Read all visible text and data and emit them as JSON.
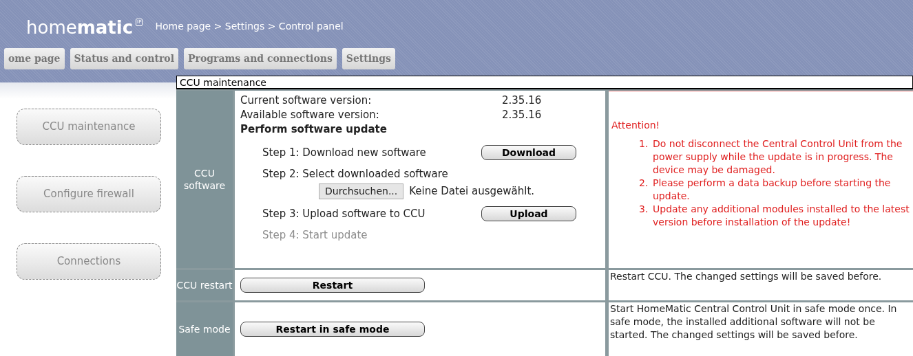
{
  "header": {
    "logo": {
      "light": "home",
      "bold": "matic",
      "badge": "IP"
    },
    "breadcrumb": "Home page > Settings > Control panel"
  },
  "tabs": [
    {
      "label": "ome page"
    },
    {
      "label": "Status and control"
    },
    {
      "label": "Programs and connections"
    },
    {
      "label": "Settings"
    }
  ],
  "sidebar": {
    "items": [
      {
        "label": "CCU maintenance"
      },
      {
        "label": "Configure firewall"
      },
      {
        "label": "Connections"
      }
    ]
  },
  "panel": {
    "title": "CCU maintenance",
    "sections": [
      {
        "kind": "software",
        "label": "CCU software",
        "versions": [
          {
            "label": "Current software version:",
            "value": "2.35.16"
          },
          {
            "label": "Available software version:",
            "value": "2.35.16"
          }
        ],
        "heading": "Perform software update",
        "steps": [
          {
            "kind": "button",
            "text": "Step 1: Download new software",
            "button": "Download",
            "disabled": false
          },
          {
            "kind": "file",
            "text": "Step 2: Select downloaded software",
            "button": "Durchsuchen...",
            "file": "Keine Datei ausgewählt.",
            "disabled": false
          },
          {
            "kind": "button",
            "text": "Step 3: Upload software to CCU",
            "button": "Upload",
            "disabled": false
          },
          {
            "kind": "plain",
            "text": "Step 4: Start update",
            "disabled": true
          }
        ],
        "notice": {
          "title": "Attention!",
          "items": [
            {
              "number": "1.",
              "text": "Do not disconnect the Central Control Unit from the power supply while the update is in progress. The device may be damaged."
            },
            {
              "number": "2.",
              "text": "Please perform a data backup before starting the update."
            },
            {
              "number": "3.",
              "text": "Update any additional modules installed to the latest version before installation of the update!"
            }
          ]
        }
      },
      {
        "kind": "action",
        "label": "CCU restart",
        "button": "Restart",
        "description": "Restart CCU. The changed settings will be saved before."
      },
      {
        "kind": "action",
        "label": "Safe mode",
        "button": "Restart in safe mode",
        "description": "Start HomeMatic Central Control Unit in safe mode once. In safe mode, the installed additional software will not be started. The changed settings will be saved before."
      }
    ]
  }
}
